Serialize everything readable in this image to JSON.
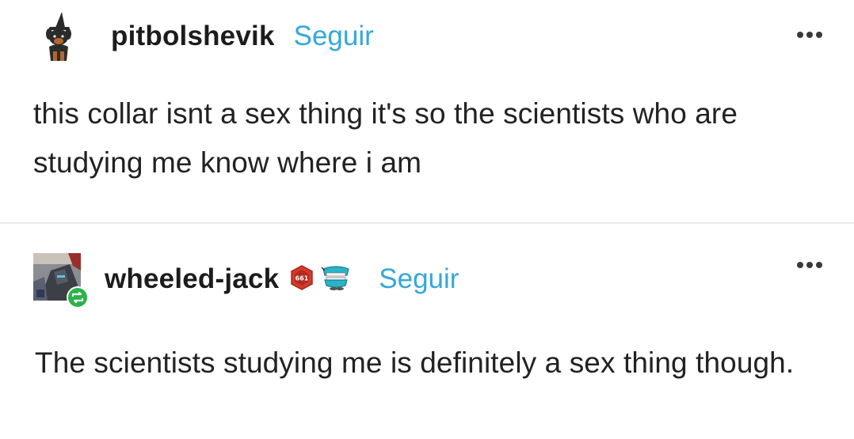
{
  "posts": [
    {
      "username": "pitbolshevik",
      "follow_label": "Seguir",
      "body": "this collar isnt a sex thing it's so the scientists who are studying me know where i am",
      "avatar_icon": "dog-witch-hat-avatar-icon",
      "more_icon": "more-options-icon"
    },
    {
      "username": "wheeled-jack",
      "follow_label": "Seguir",
      "badges": [
        {
          "icon": "hexagon-badge-icon",
          "text": "661",
          "color": "#d23b2c"
        },
        {
          "icon": "chattering-teeth-badge-icon",
          "color": "#2bb3c8"
        }
      ],
      "reblog_icon": "reblog-icon",
      "reblog_color": "#2cb34a",
      "body": "The scientists studying me is definitely a sex thing though.",
      "avatar_icon": "robot-avatar-icon",
      "more_icon": "more-options-icon"
    }
  ],
  "colors": {
    "follow_link": "#35a8d9",
    "divider": "#ececec"
  }
}
